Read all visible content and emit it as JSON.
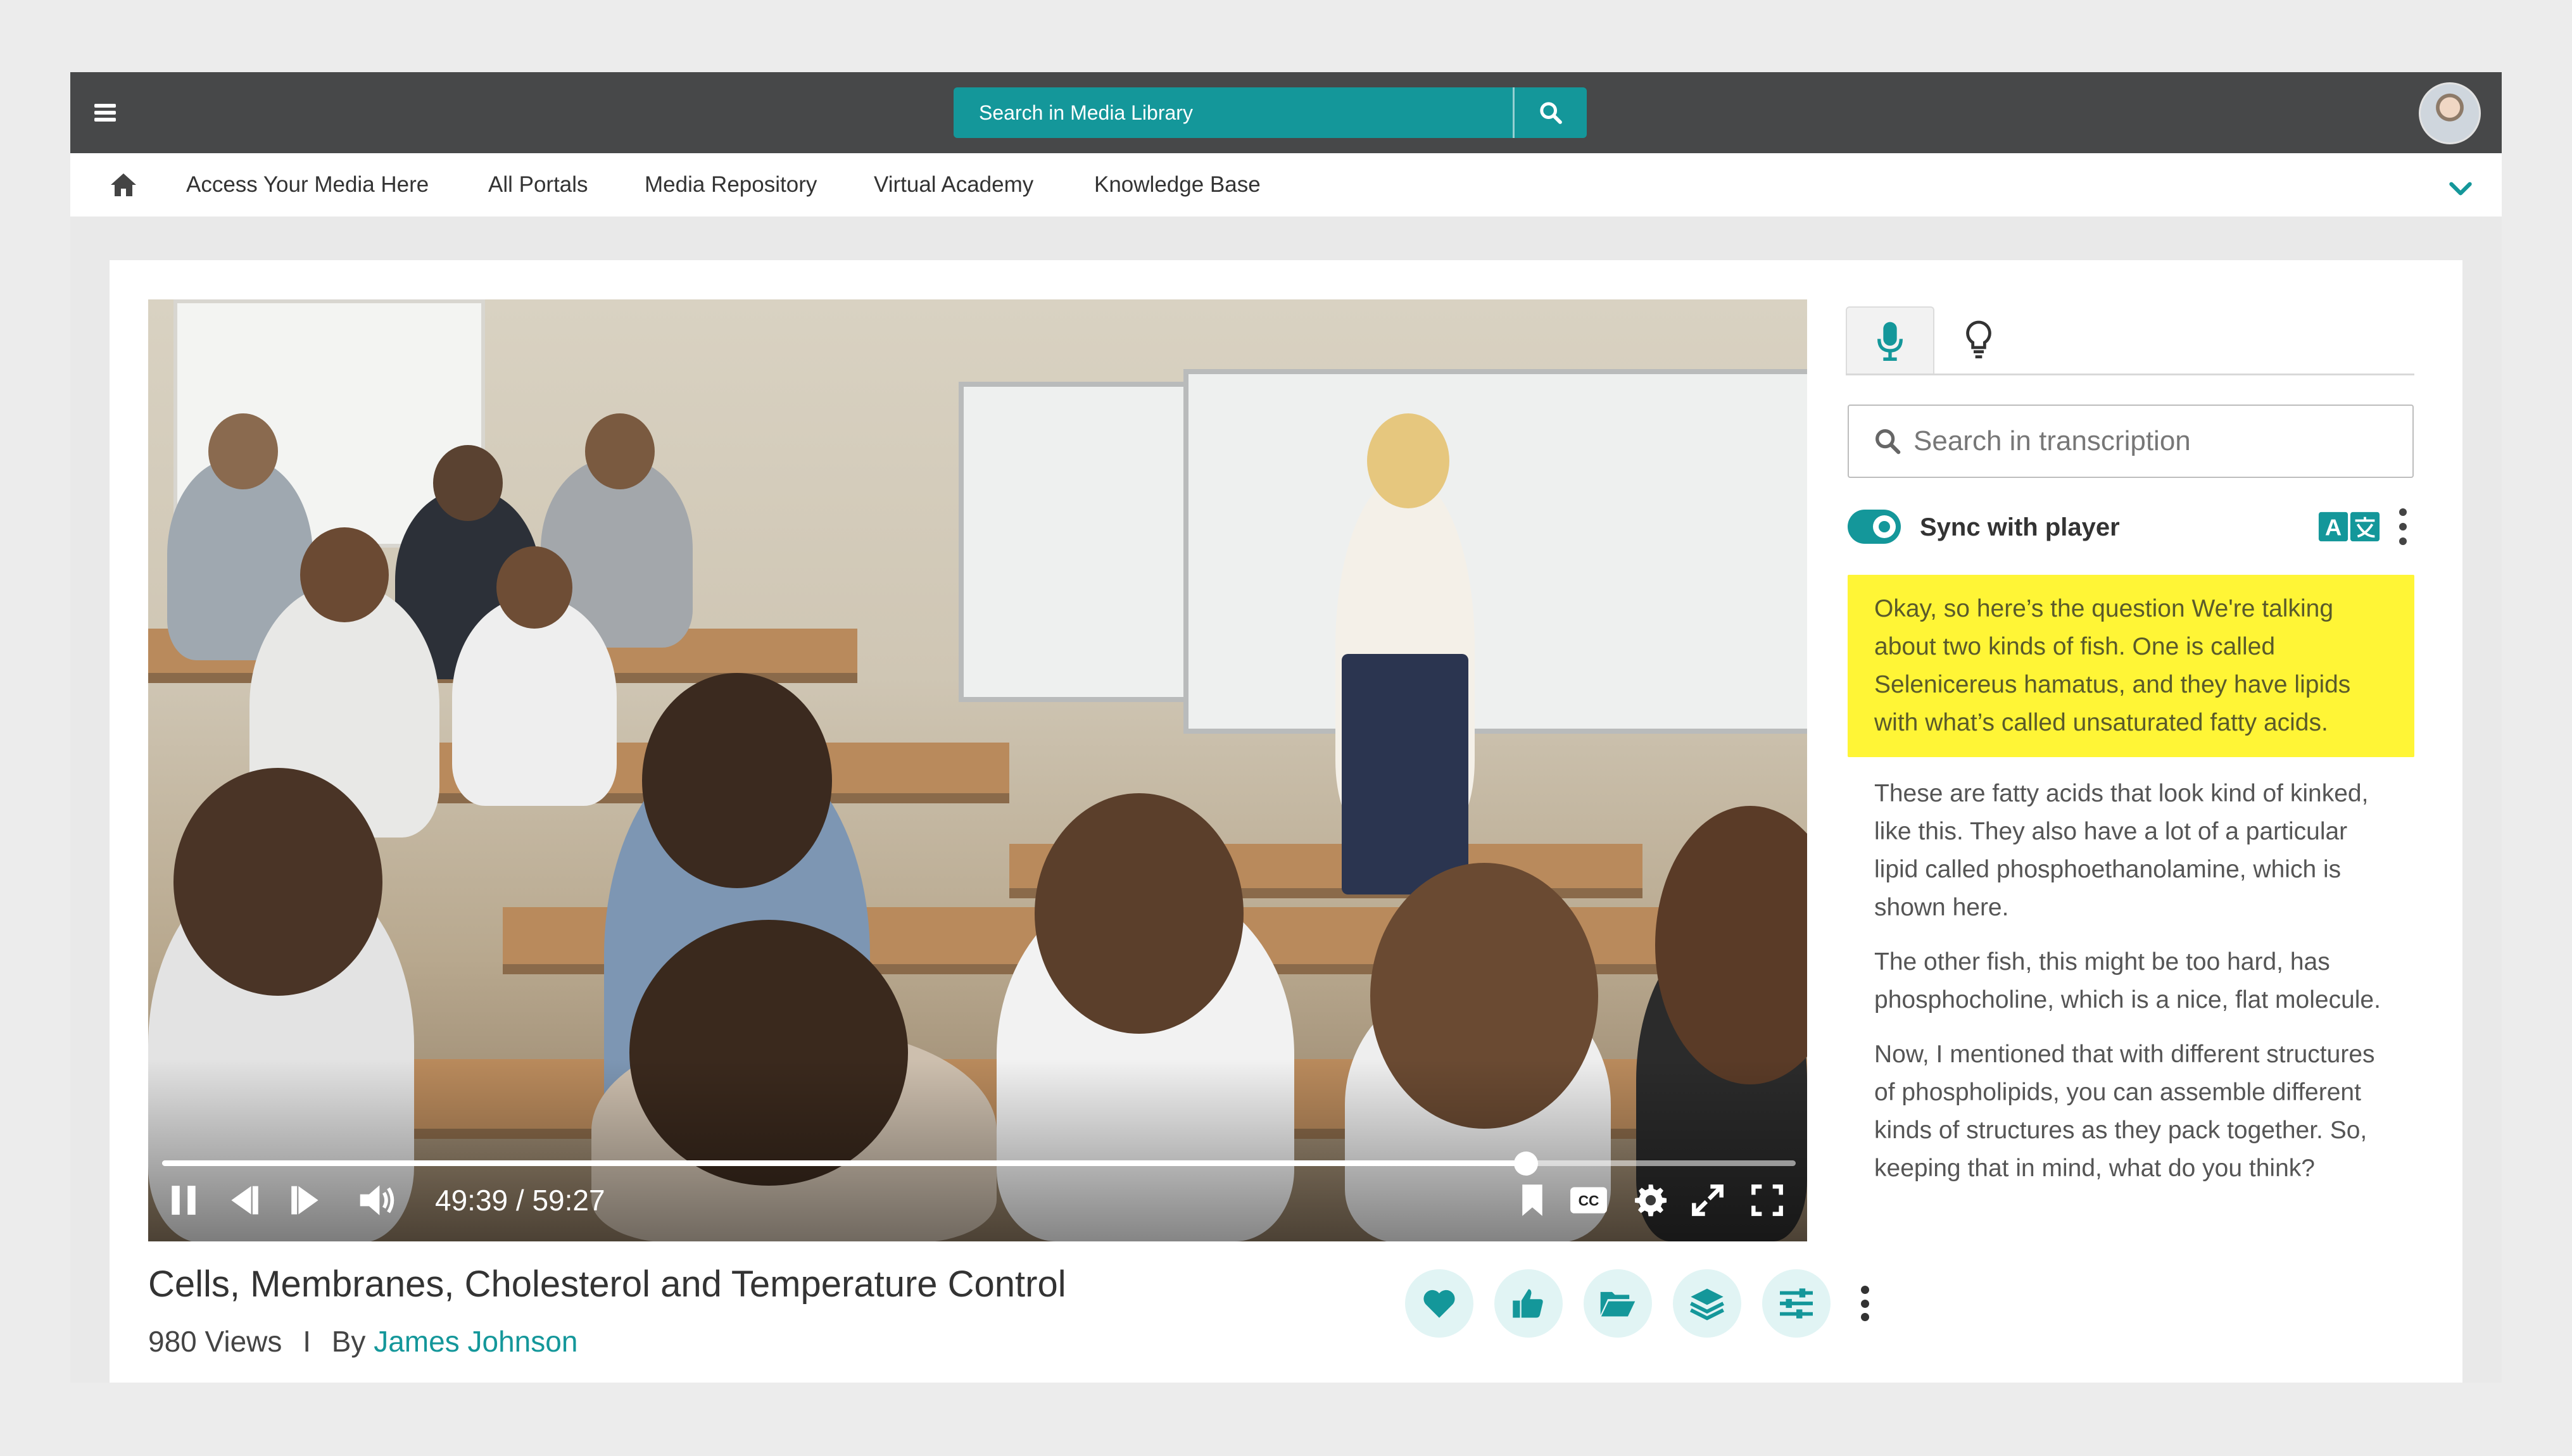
{
  "header": {
    "search_placeholder": "Search in Media Library"
  },
  "nav": {
    "items": [
      {
        "label": "Access Your Media Here"
      },
      {
        "label": "All Portals"
      },
      {
        "label": "Media Repository"
      },
      {
        "label": "Virtual Academy"
      },
      {
        "label": "Knowledge Base"
      }
    ]
  },
  "player": {
    "current_time": "49:39",
    "duration": "59:27",
    "time_display": "49:39 / 59:27",
    "progress": 0.835
  },
  "media": {
    "title": "Cells, Membranes, Cholesterol and Temperature Control",
    "views": "980 Views",
    "separator": "I",
    "by_label": "By",
    "author": "James Johnson"
  },
  "transcript": {
    "search_placeholder": "Search in transcription",
    "sync_label": "Sync with player",
    "sync_enabled": true,
    "paragraphs": [
      {
        "text": "Okay, so here’s the question We're talking about two kinds of fish. One is called Selenicereus hamatus, and they have lipids with what’s called unsaturated fatty acids.",
        "highlighted": true
      },
      {
        "text": "These are fatty acids that look kind of kinked, like this. They also have a lot of a particular lipid called phosphoethanolamine, which is shown here.",
        "highlighted": false
      },
      {
        "text": "The other fish, this might be too hard, has phosphocholine, which is a nice, flat molecule.",
        "highlighted": false
      },
      {
        "text": "Now, I mentioned that with different structures of phospholipids, you can assemble different kinds of structures as they pack together. So, keeping that in mind, what do you think?",
        "highlighted": false
      }
    ]
  },
  "colors": {
    "accent": "#14979a",
    "topbar": "#474849",
    "highlight": "#fff536",
    "action_bg": "#e1f4f4"
  },
  "icons": {
    "menu": "hamburger-icon",
    "search": "search-icon",
    "home": "home-icon",
    "expand": "chevron-down-icon",
    "mic": "microphone-icon",
    "insight": "lightbulb-icon",
    "translate": "translate-icon",
    "actions": [
      "heart-icon",
      "thumbs-up-icon",
      "folder-open-icon",
      "layers-icon",
      "sliders-icon"
    ]
  }
}
